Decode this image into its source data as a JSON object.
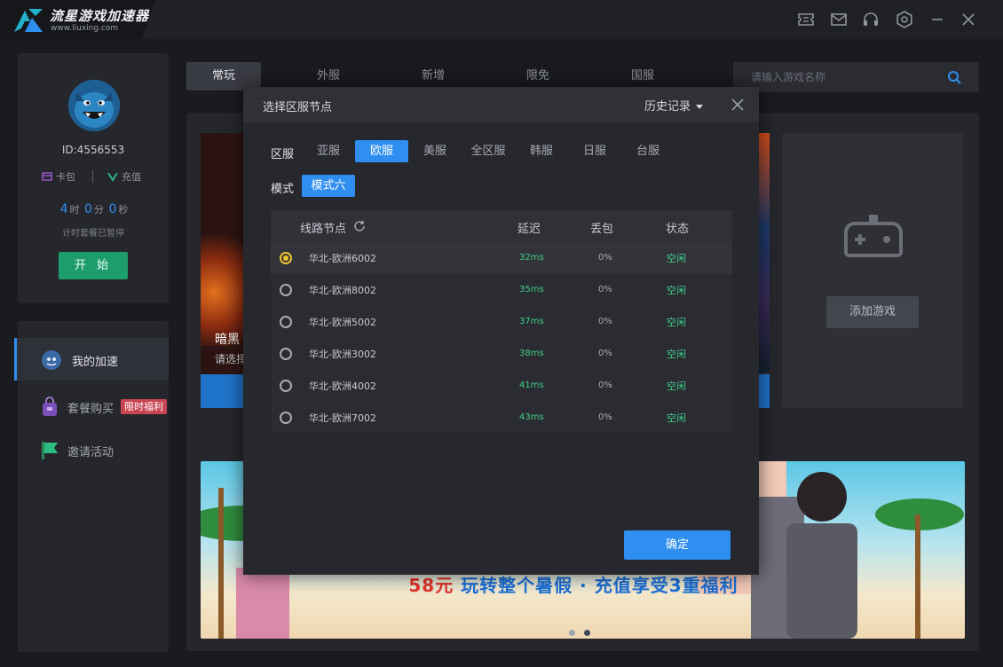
{
  "app": {
    "title": "流星游戏加速器",
    "url": "www.liuxing.com",
    "accent": "#2f8ff0"
  },
  "titlebar_icons": [
    "ticket-icon",
    "mail-icon",
    "headset-icon",
    "settings-icon",
    "minimize-icon",
    "close-icon"
  ],
  "profile": {
    "id_label": "ID:4556553",
    "wallet_label": "卡包",
    "recharge_label": "充值",
    "timer": {
      "hours": "4",
      "hours_unit": "时",
      "minutes": "0",
      "minutes_unit": "分",
      "seconds": "0",
      "seconds_unit": "秒"
    },
    "timer_note": "计时套餐已暂停",
    "start_label": "开 始"
  },
  "nav": [
    {
      "label": "我的加速",
      "icon": "rocket-icon",
      "active": true
    },
    {
      "label": "套餐购买",
      "icon": "bag-icon",
      "badge": "限时福利"
    },
    {
      "label": "邀请活动",
      "icon": "flag-icon"
    }
  ],
  "tabs": [
    "常玩",
    "外服",
    "新增",
    "限免",
    "国服"
  ],
  "search": {
    "placeholder": "请输入游戏名称"
  },
  "game_card": {
    "name": "暗黑",
    "sub": "请选择"
  },
  "add_game": {
    "label": "添加游戏"
  },
  "banner": {
    "price": "58元",
    "text": " 玩转整个暑假 · 充值享受3重福利"
  },
  "modal": {
    "title": "选择区服节点",
    "history_label": "历史记录",
    "region_label": "区服",
    "regions": [
      "亚服",
      "欧服",
      "美服",
      "全区服",
      "韩服",
      "日服",
      "台服"
    ],
    "active_region": "欧服",
    "mode_label": "模式",
    "mode_value": "模式六",
    "columns": {
      "node": "线路节点",
      "latency": "延迟",
      "loss": "丢包",
      "status": "状态"
    },
    "nodes": [
      {
        "name": "华北-欧洲6002",
        "latency": "32ms",
        "loss": "0%",
        "status": "空闲",
        "selected": true
      },
      {
        "name": "华北-欧洲8002",
        "latency": "35ms",
        "loss": "0%",
        "status": "空闲"
      },
      {
        "name": "华北-欧洲5002",
        "latency": "37ms",
        "loss": "0%",
        "status": "空闲"
      },
      {
        "name": "华北-欧洲3002",
        "latency": "38ms",
        "loss": "0%",
        "status": "空闲"
      },
      {
        "name": "华北-欧洲4002",
        "latency": "41ms",
        "loss": "0%",
        "status": "空闲"
      },
      {
        "name": "华北-欧洲7002",
        "latency": "43ms",
        "loss": "0%",
        "status": "空闲"
      }
    ],
    "confirm_label": "确定"
  }
}
